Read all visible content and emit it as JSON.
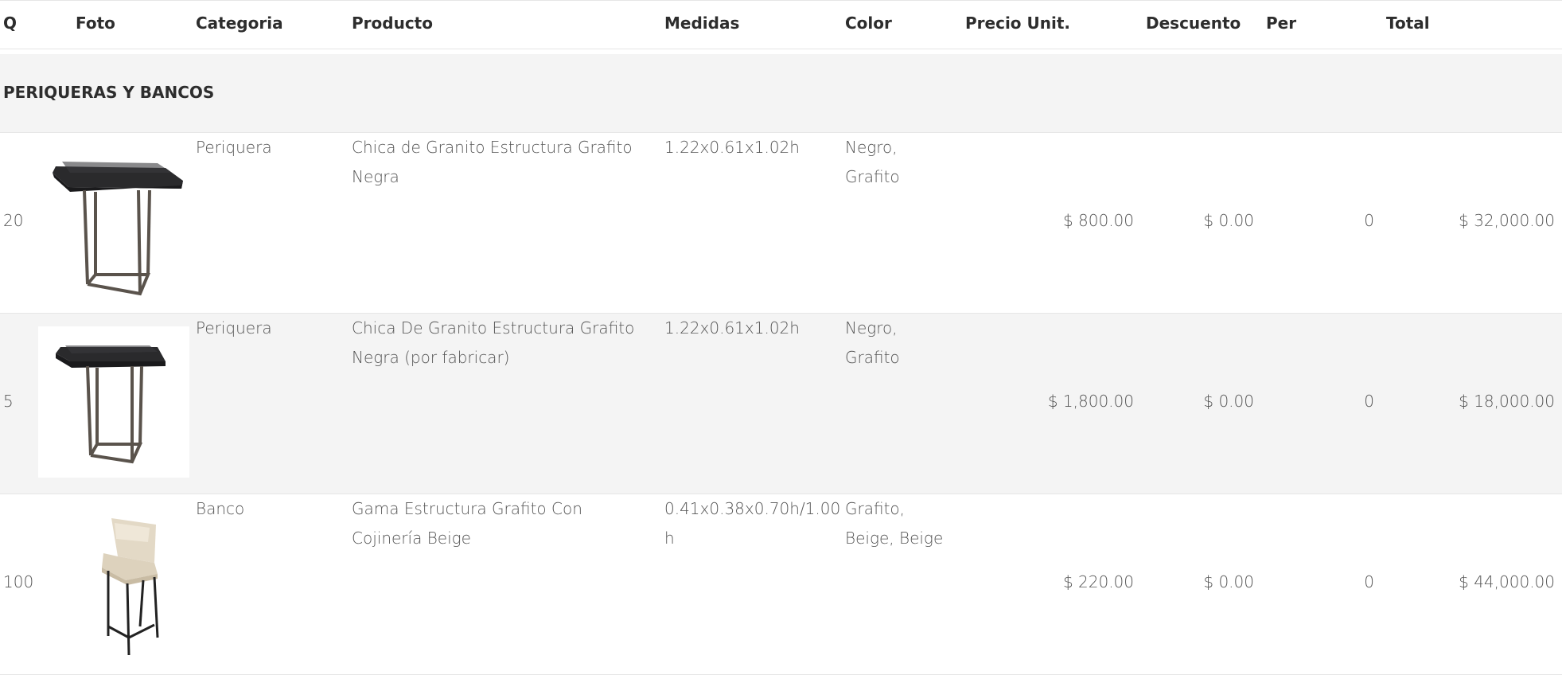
{
  "columns": {
    "q": "Q",
    "foto": "Foto",
    "categoria": "Categoria",
    "producto": "Producto",
    "medidas": "Medidas",
    "color": "Color",
    "precio": "Precio Unit.",
    "descuento": "Descuento",
    "per": "Per",
    "total": "Total"
  },
  "section": {
    "title": "PERIQUERAS Y BANCOS"
  },
  "rows": [
    {
      "q": "20",
      "photo_icon": "periquera-table-image",
      "categoria": "Periquera",
      "producto_l1": "Chica de Granito Estructura Grafito",
      "producto_l2": "Negra",
      "medidas_l1": "1.22x0.61x1.02h",
      "medidas_l2": "",
      "color_l1": "Negro,",
      "color_l2": "Grafito",
      "precio": "$ 800.00",
      "descuento": "$ 0.00",
      "per": "0",
      "total": "$ 32,000.00"
    },
    {
      "q": "5",
      "photo_icon": "periquera-table-image",
      "categoria": "Periquera",
      "producto_l1": "Chica De Granito Estructura Grafito",
      "producto_l2": "Negra (por fabricar)",
      "medidas_l1": "1.22x0.61x1.02h",
      "medidas_l2": "",
      "color_l1": "Negro,",
      "color_l2": "Grafito",
      "precio": "$ 1,800.00",
      "descuento": "$ 0.00",
      "per": "0",
      "total": "$ 18,000.00"
    },
    {
      "q": "100",
      "photo_icon": "bar-stool-image",
      "categoria": "Banco",
      "producto_l1": "Gama Estructura Grafito Con",
      "producto_l2": "Cojinería Beige",
      "medidas_l1": "0.41x0.38x0.70h/1.00",
      "medidas_l2": "h",
      "color_l1": "Grafito,",
      "color_l2": "Beige, Beige",
      "precio": "$ 220.00",
      "descuento": "$ 0.00",
      "per": "0",
      "total": "$ 44,000.00"
    }
  ]
}
